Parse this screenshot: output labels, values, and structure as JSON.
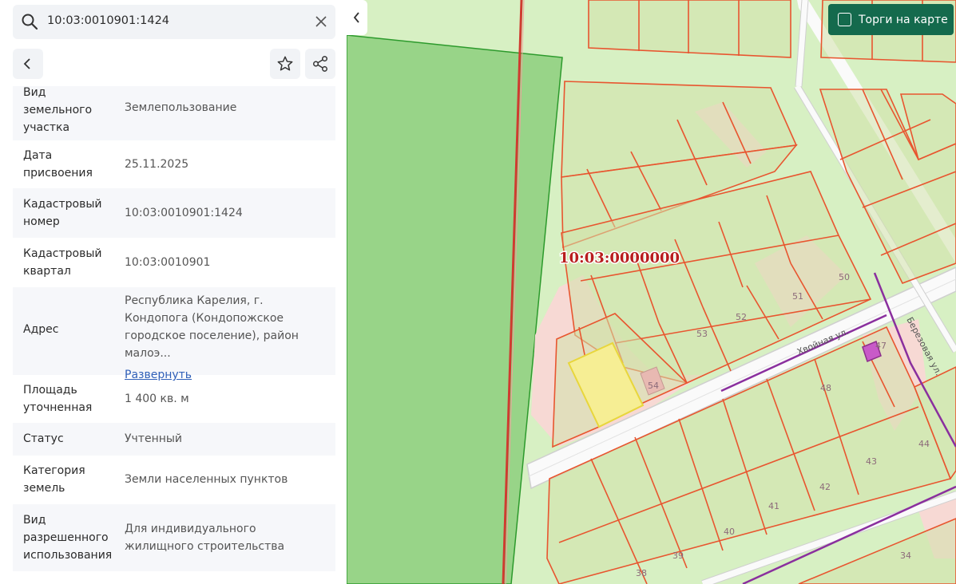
{
  "search": {
    "value": "10:03:0010901:1424"
  },
  "details": [
    {
      "label": "Вид земельного участка",
      "value": "Землепользование"
    },
    {
      "label": "Дата присвоения",
      "value": "25.11.2025"
    },
    {
      "label": "Кадастровый номер",
      "value": "10:03:0010901:1424"
    },
    {
      "label": "Кадастровый квартал",
      "value": "10:03:0010901"
    },
    {
      "label": "Адрес",
      "value": "Республика Карелия, г. Кондопога (Кондопожское городское поселение), район малоэ...",
      "link": "Развернуть"
    },
    {
      "label": "Площадь уточненная",
      "value": "1 400 кв. м"
    },
    {
      "label": "Статус",
      "value": "Учтенный"
    },
    {
      "label": "Категория земель",
      "value": "Земли населенных пунктов"
    },
    {
      "label": "Вид разрешенного использования",
      "value": "Для индивидуального жилищного строительства"
    }
  ],
  "map": {
    "quarter_label": "10:03:0000000",
    "street_1": "Хвойная ул.",
    "street_2": "Березовая ул.",
    "lots": [
      "50",
      "51",
      "52",
      "53",
      "54",
      "48",
      "47",
      "44",
      "43",
      "42",
      "41",
      "40",
      "39",
      "38",
      "34"
    ],
    "torgi_label": "Торги на карте",
    "colors": {
      "forest": "#98d488",
      "meadow": "#d7f0c3",
      "parcel_border": "#e8552f",
      "selected": "#f6ee94",
      "button": "#146a4d"
    }
  }
}
